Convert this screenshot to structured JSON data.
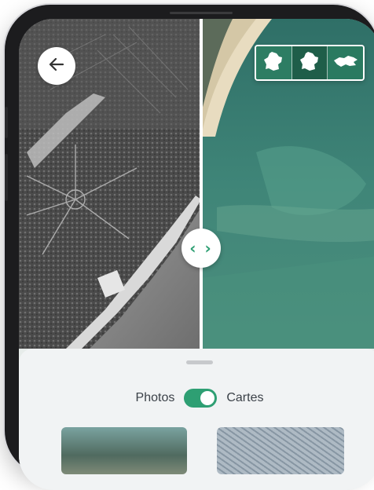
{
  "map": {
    "left_layer": "historic-aerial-photo",
    "right_layer": "current-satellite-photo",
    "compare_handle_icon": "compare-arrows-icon",
    "compare_handle_text": "‹ ›"
  },
  "back_button": {
    "icon": "back-arrow-icon",
    "glyph": "←"
  },
  "territory_switcher": {
    "options": [
      {
        "icon": "france-map-icon",
        "state": "default"
      },
      {
        "icon": "france-map-icon",
        "state": "selected"
      },
      {
        "icon": "overseas-map-icon",
        "state": "default"
      }
    ]
  },
  "bottom_sheet": {
    "toggle": {
      "left_label": "Photos",
      "right_label": "Cartes",
      "state": "on"
    },
    "thumbnails": [
      {
        "kind": "photo"
      },
      {
        "kind": "map"
      }
    ]
  },
  "colors": {
    "accent": "#2e9f73",
    "sheet_bg": "#f1f3f4",
    "text": "#3b4148"
  }
}
